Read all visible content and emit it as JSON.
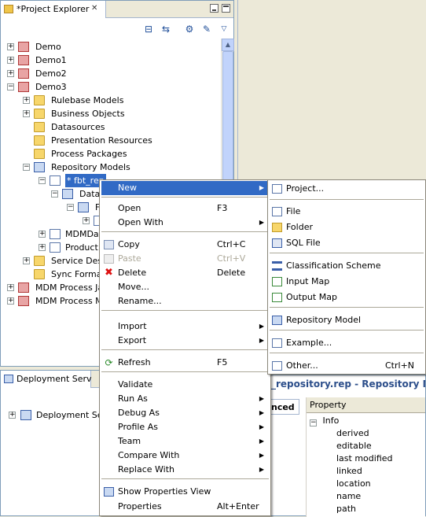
{
  "project_explorer": {
    "tab_title": "*Project Explorer",
    "tree": [
      {
        "label": "Demo",
        "expander": "+"
      },
      {
        "label": "Demo1",
        "expander": "+"
      },
      {
        "label": "Demo2",
        "expander": "+"
      },
      {
        "label": "Demo3",
        "expander": "−"
      },
      {
        "label": "Rulebase Models",
        "expander": "+"
      },
      {
        "label": "Business Objects",
        "expander": "+"
      },
      {
        "label": "Datasources",
        "expander": ""
      },
      {
        "label": "Presentation Resources",
        "expander": ""
      },
      {
        "label": "Process Packages",
        "expander": ""
      },
      {
        "label": "Repository Models",
        "expander": "−"
      },
      {
        "label": "* fbt_rep",
        "expander": "−"
      },
      {
        "label": "Data",
        "expander": "−"
      },
      {
        "label": "F",
        "expander": "−"
      },
      {
        "label": "",
        "expander": "+"
      },
      {
        "label": "MDMData",
        "expander": "+"
      },
      {
        "label": "Product.",
        "expander": "+"
      },
      {
        "label": "Service Desc",
        "expander": "+"
      },
      {
        "label": "Sync Format",
        "expander": ""
      },
      {
        "label": "MDM Process Jav",
        "expander": "+"
      },
      {
        "label": "MDM Process Mo",
        "expander": "+"
      }
    ]
  },
  "deployment": {
    "tab_title": "Deployment Serv",
    "items": [
      {
        "label": "Deployment Serv",
        "expander": "+"
      }
    ]
  },
  "properties": {
    "title": "_repository.rep - Repository M",
    "side_tab": "nced",
    "column_header": "Property",
    "group": "Info",
    "rows": [
      "derived",
      "editable",
      "last modified",
      "linked",
      "location",
      "name",
      "path"
    ]
  },
  "context_menu": {
    "items": [
      {
        "label": "New",
        "shortcut": "",
        "submenu": true,
        "active": true
      },
      {
        "separator": true
      },
      {
        "label": "Open",
        "shortcut": "F3"
      },
      {
        "label": "Open With",
        "shortcut": "",
        "submenu": true
      },
      {
        "separator": true
      },
      {
        "label": "Copy",
        "shortcut": "Ctrl+C",
        "icon": "copy-icon"
      },
      {
        "label": "Paste",
        "shortcut": "Ctrl+V",
        "icon": "paste-icon",
        "disabled": true
      },
      {
        "label": "Delete",
        "shortcut": "Delete",
        "icon": "delete-icon"
      },
      {
        "label": "Move...",
        "shortcut": ""
      },
      {
        "label": "Rename...",
        "shortcut": ""
      },
      {
        "separator": true
      },
      {
        "label": "Import",
        "shortcut": "",
        "submenu": true
      },
      {
        "label": "Export",
        "shortcut": "",
        "submenu": true
      },
      {
        "separator": true
      },
      {
        "label": "Refresh",
        "shortcut": "F5",
        "icon": "refresh-icon"
      },
      {
        "separator": true
      },
      {
        "label": "Validate",
        "shortcut": ""
      },
      {
        "label": "Run As",
        "shortcut": "",
        "submenu": true
      },
      {
        "label": "Debug As",
        "shortcut": "",
        "submenu": true
      },
      {
        "label": "Profile As",
        "shortcut": "",
        "submenu": true
      },
      {
        "label": "Team",
        "shortcut": "",
        "submenu": true
      },
      {
        "label": "Compare With",
        "shortcut": "",
        "submenu": true
      },
      {
        "label": "Replace With",
        "shortcut": "",
        "submenu": true
      },
      {
        "separator": true
      },
      {
        "label": "Show Properties View",
        "shortcut": "",
        "icon": "properties-view-icon"
      },
      {
        "label": "Properties",
        "shortcut": "Alt+Enter"
      }
    ]
  },
  "new_submenu": {
    "items": [
      {
        "label": "Project...",
        "shortcut": "",
        "icon": "new-project-icon"
      },
      {
        "separator": true
      },
      {
        "label": "File",
        "shortcut": "",
        "icon": "file-icon"
      },
      {
        "label": "Folder",
        "shortcut": "",
        "icon": "folder-icon"
      },
      {
        "label": "SQL File",
        "shortcut": "",
        "icon": "sql-file-icon"
      },
      {
        "separator": true
      },
      {
        "label": "Classification Scheme",
        "shortcut": "",
        "icon": "classification-scheme-icon"
      },
      {
        "label": "Input Map",
        "shortcut": "",
        "icon": "input-map-icon"
      },
      {
        "label": "Output Map",
        "shortcut": "",
        "icon": "output-map-icon"
      },
      {
        "separator": true
      },
      {
        "label": "Repository Model",
        "shortcut": "",
        "icon": "repository-model-icon"
      },
      {
        "separator": true
      },
      {
        "label": "Example...",
        "shortcut": "",
        "icon": "example-icon"
      },
      {
        "separator": true
      },
      {
        "label": "Other...",
        "shortcut": "Ctrl+N",
        "icon": "other-wizard-icon"
      }
    ]
  }
}
